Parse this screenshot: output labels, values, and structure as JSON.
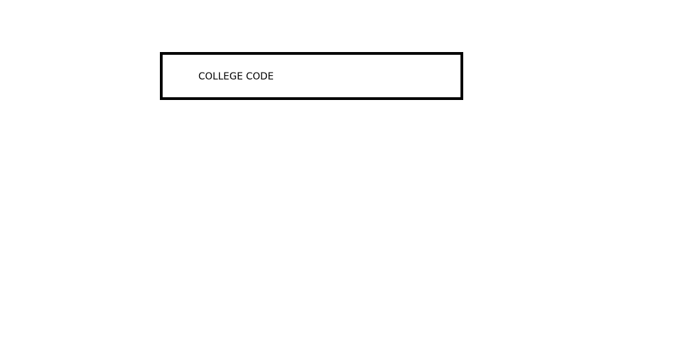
{
  "field": {
    "label": "COLLEGE CODE"
  },
  "colors": {
    "border": "#000000",
    "text": "#000000",
    "background": "#ffffff"
  }
}
